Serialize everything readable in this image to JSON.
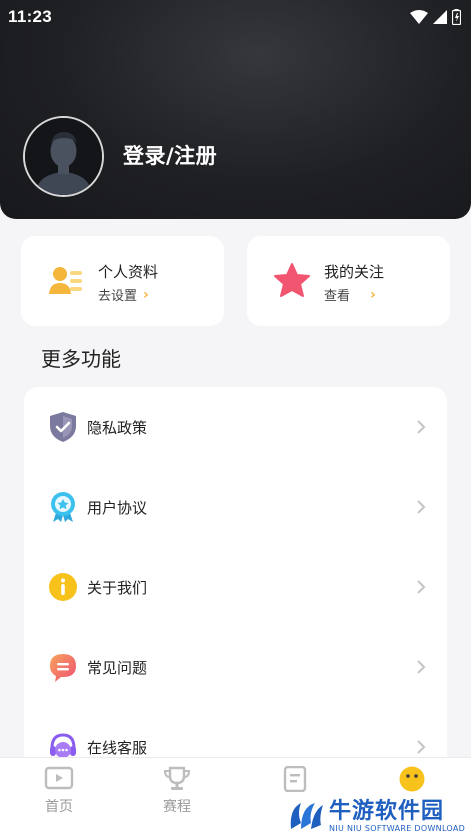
{
  "status_bar": {
    "time": "11:23"
  },
  "header": {
    "login_label": "登录/注册"
  },
  "cards": [
    {
      "title": "个人资料",
      "sub": "去设置",
      "icon": "profile-card-icon",
      "color": "#f4b63b"
    },
    {
      "title": "我的关注",
      "sub": "查看",
      "icon": "star-icon",
      "color": "#f2556f"
    }
  ],
  "more": {
    "title": "更多功能",
    "items": [
      {
        "label": "隐私政策",
        "icon": "shield-icon"
      },
      {
        "label": "用户协议",
        "icon": "badge-icon"
      },
      {
        "label": "关于我们",
        "icon": "info-icon"
      },
      {
        "label": "常见问题",
        "icon": "chat-bubble-icon"
      },
      {
        "label": "在线客服",
        "icon": "headset-icon"
      }
    ]
  },
  "tabs": [
    {
      "label": "首页",
      "icon": "play-screen-icon"
    },
    {
      "label": "赛程",
      "icon": "trophy-icon"
    },
    {
      "label": "",
      "icon": "document-icon"
    },
    {
      "label": "",
      "icon": "smiley-face-icon",
      "active": true
    }
  ],
  "watermark": {
    "main": "牛游软件园",
    "sub": "NIU NIU SOFTWARE DOWNLOAD"
  },
  "colors": {
    "accent": "#f4b63b",
    "header_bg": "#1f2024",
    "brand_blue": "#1f5fbf"
  }
}
